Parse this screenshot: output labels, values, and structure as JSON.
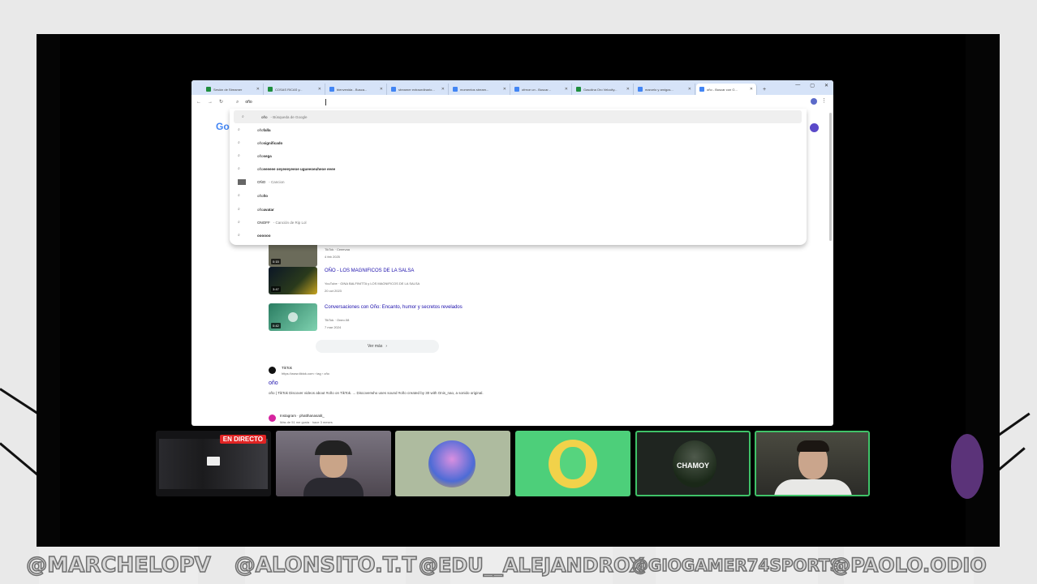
{
  "browser": {
    "tabs": [
      {
        "label": "Sesión de Streamer",
        "color": "#1e8e3e"
      },
      {
        "label": "COSAS RICAS y...",
        "color": "#1e8e3e"
      },
      {
        "label": "bienvenida - Busca...",
        "color": "#1e8e3e"
      },
      {
        "label": "streamer extraordinario...",
        "color": "#1e8e3e"
      },
      {
        "label": "momentos stream...",
        "color": "#1e8e3e"
      },
      {
        "label": "ofrece un - Buscar...",
        "color": "#1e8e3e"
      },
      {
        "label": "Gasolina Oro Velocity...",
        "color": "#1e8e3e"
      },
      {
        "label": "marcelo y amigos...",
        "color": "#1e8e3e"
      },
      {
        "label": "oño - Buscar con G...",
        "color": "#4285f4"
      }
    ],
    "omnibox_value": "oño",
    "logo": "Go",
    "suggestions": [
      {
        "text": "oño",
        "sub": "- Búsqueda de Google",
        "bold": "",
        "icon": "search"
      },
      {
        "text": "oño",
        "bold": "falla",
        "sub": "",
        "icon": "search"
      },
      {
        "text": "oño",
        "bold": " significado",
        "sub": "",
        "icon": "search"
      },
      {
        "text": "oño",
        "bold": "sega",
        "sub": "",
        "icon": "search"
      },
      {
        "text": "oño",
        "bold": "eeeeee oeyeeeyeeoe ugueeoeuheoe eeee",
        "sub": "",
        "icon": "search"
      },
      {
        "text": "OÑO",
        "bold": "",
        "sub": "- Cancion",
        "icon": "image"
      },
      {
        "text": "oño",
        "bold": "ño",
        "sub": "",
        "icon": "search"
      },
      {
        "text": "oño",
        "bold": " avatar",
        "sub": "",
        "icon": "search"
      },
      {
        "text": "ONOFF",
        "bold": "",
        "sub": "- Canción de Rip Lol",
        "icon": "search"
      },
      {
        "text": "",
        "bold": "oooooo",
        "sub": "",
        "icon": "search"
      }
    ],
    "results": [
      {
        "title": "",
        "meta": "TikTok · Ceeevaa",
        "date": "4 feb 2025",
        "duration": "0:15"
      },
      {
        "title": "OÑO - LOS MAGNIFICOS DE LA SALSA",
        "meta": "YouTube · GINA BALFINITTA y LOS MAGNIFICOS DE LA SALSA",
        "date": "20 oct 2023",
        "duration": "3:47"
      },
      {
        "title": "Conversaciones con Oño: Encanto, humor y secretos revelados",
        "meta": "TikTok · Oneo.08",
        "date": "7 mar 2024",
        "duration": "0:42"
      }
    ],
    "see_more": "Ver más",
    "tiktok": {
      "name": "TikTok",
      "url": "https://www.tiktok.com › tag › oño",
      "title": "oño",
      "snippet": "oño | TikTok Discover videos about #oño on TikTok. ... Discoverwho uses sound #oño created by 30 with Onis_nao, a sonido original."
    },
    "instagram": {
      "name": "Instagram · phatthanasatit_",
      "url": "Más de 51 me gusta · hace 3 meses"
    }
  },
  "call": {
    "live_badge": "EN DIRECTO",
    "chamoy_label": "CHAMOY"
  },
  "usernames": [
    "@MARCHELOPV",
    "@ALONSITO.T.T",
    "@EDU__ALEJANDROX",
    "@GIOGAMER74SPORTS",
    "@PAOLO.ODIO"
  ]
}
